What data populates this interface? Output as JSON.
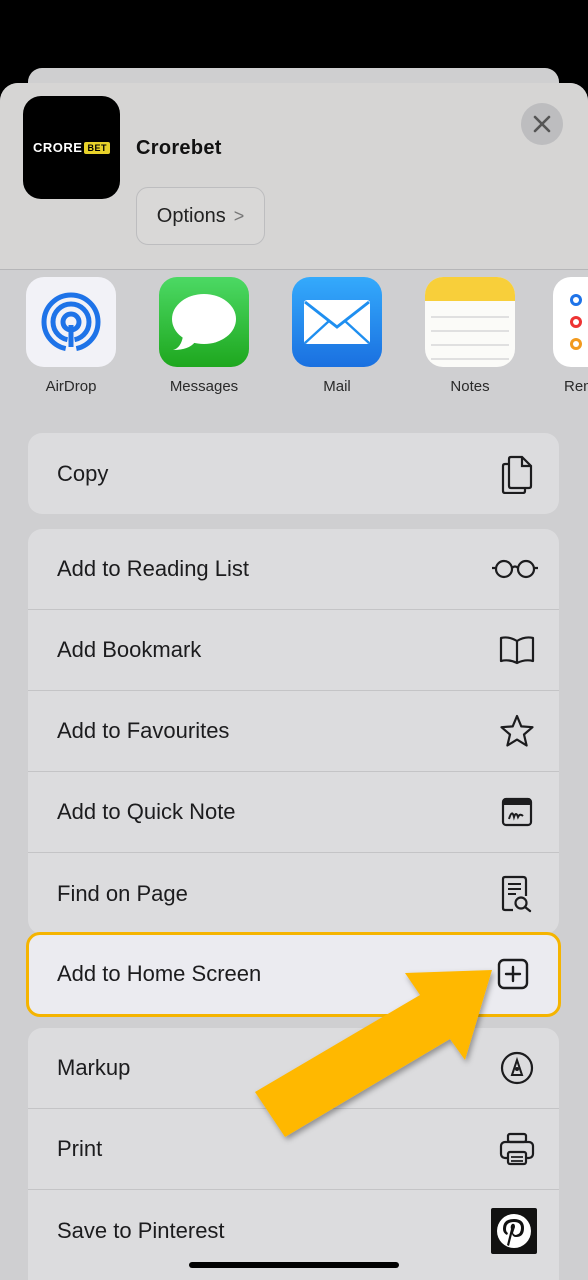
{
  "header": {
    "app_name": "Crorebet",
    "logo_word": "CRORE",
    "logo_badge": "BET",
    "options_label": "Options",
    "options_chevron": ">",
    "close_icon": "close-icon"
  },
  "share_apps": [
    {
      "label": "AirDrop",
      "icon": "airdrop-icon",
      "color": "#f2f2f7"
    },
    {
      "label": "Messages",
      "icon": "messages-icon",
      "color": "#3ec63e"
    },
    {
      "label": "Mail",
      "icon": "mail-icon",
      "color": "#1f8ff0"
    },
    {
      "label": "Notes",
      "icon": "notes-icon",
      "color": "#fbfbf8"
    },
    {
      "label": "Rem",
      "icon": "reminders-icon",
      "color": "#ffffff"
    }
  ],
  "copy_group": {
    "copy_label": "Copy"
  },
  "actions_group": {
    "reading_list": "Add to Reading List",
    "bookmark": "Add Bookmark",
    "favourites": "Add to Favourites",
    "quick_note": "Add to Quick Note",
    "find_on_page": "Find on Page"
  },
  "highlighted_action": {
    "label": "Add to Home Screen",
    "accent": "#f5b400"
  },
  "bottom_group": {
    "markup": "Markup",
    "print": "Print",
    "pinterest": "Save to Pinterest"
  }
}
